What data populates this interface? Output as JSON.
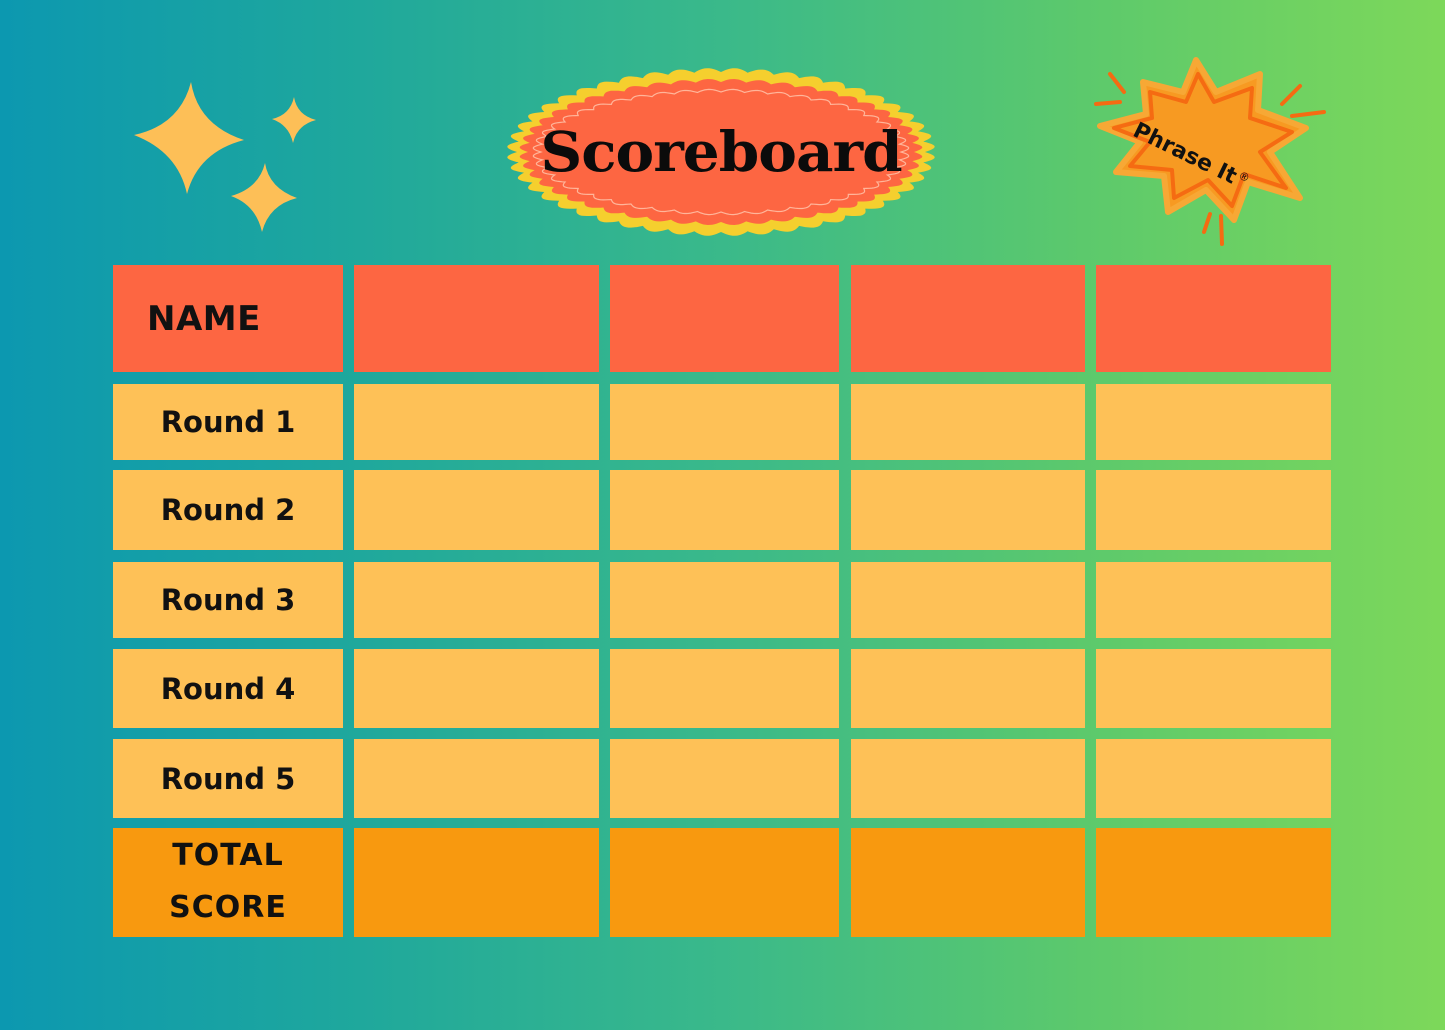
{
  "title": "Scoreboard",
  "logo": {
    "text": "Phrase It",
    "mark": "®"
  },
  "decorations": {
    "sparkles_icon": "four-point-stars"
  },
  "colors": {
    "background_left": "#0c98b0",
    "background_right": "#7dd85a",
    "header_row": "#fd6642",
    "round_rows": "#fec157",
    "total_row": "#f8990f",
    "title_badge_fill": "#fd6642",
    "title_badge_border": "#f5cf2e",
    "sparkle": "#fdbf57",
    "logo_fill": "#f79a22",
    "logo_stroke": "#f56b12"
  },
  "table": {
    "player_columns": 4,
    "rows": [
      {
        "label": "NAME",
        "type": "header",
        "values": [
          "",
          "",
          "",
          ""
        ]
      },
      {
        "label": "Round 1",
        "type": "round",
        "values": [
          "",
          "",
          "",
          ""
        ]
      },
      {
        "label": "Round 2",
        "type": "round",
        "values": [
          "",
          "",
          "",
          ""
        ]
      },
      {
        "label": "Round 3",
        "type": "round",
        "values": [
          "",
          "",
          "",
          ""
        ]
      },
      {
        "label": "Round 4",
        "type": "round",
        "values": [
          "",
          "",
          "",
          ""
        ]
      },
      {
        "label": "Round 5",
        "type": "round",
        "values": [
          "",
          "",
          "",
          ""
        ]
      },
      {
        "label": "TOTAL SCORE",
        "label_lines": [
          "TOTAL",
          "SCORE"
        ],
        "type": "total",
        "values": [
          "",
          "",
          "",
          ""
        ]
      }
    ]
  }
}
